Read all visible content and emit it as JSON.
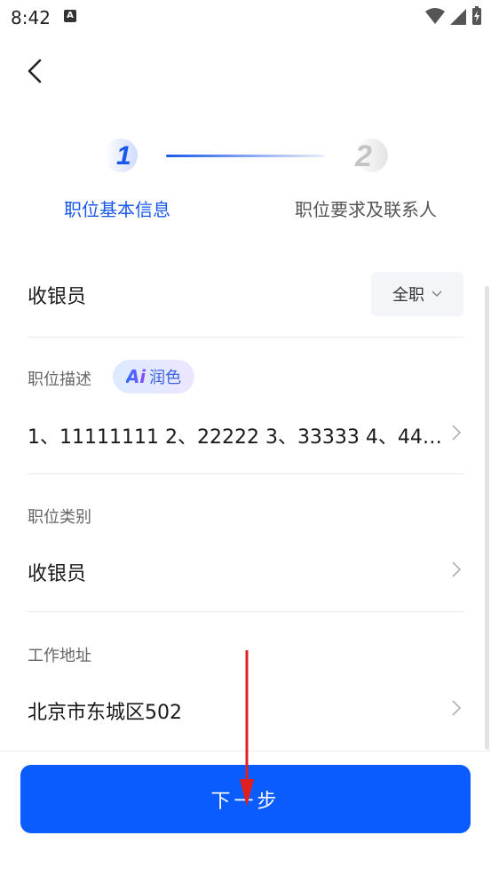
{
  "status": {
    "time": "8:42",
    "notif_glyph": "A"
  },
  "steps": [
    {
      "number": "1",
      "label": "职位基本信息",
      "active": true
    },
    {
      "number": "2",
      "label": "职位要求及联系人",
      "active": false
    }
  ],
  "job": {
    "title": "收银员",
    "type": "全职"
  },
  "fields": {
    "description": {
      "label": "职位描述",
      "ai_logo": "Ai",
      "ai_label": "润色",
      "value": "1、11111111 2、22222 3、33333 4、44…"
    },
    "category": {
      "label": "职位类别",
      "value": "收银员"
    },
    "address": {
      "label": "工作地址",
      "value": "北京市东城区502"
    }
  },
  "footer": {
    "next_label": "下一步"
  },
  "colors": {
    "accent": "#0a5cff",
    "active_step": "#1757e9"
  }
}
